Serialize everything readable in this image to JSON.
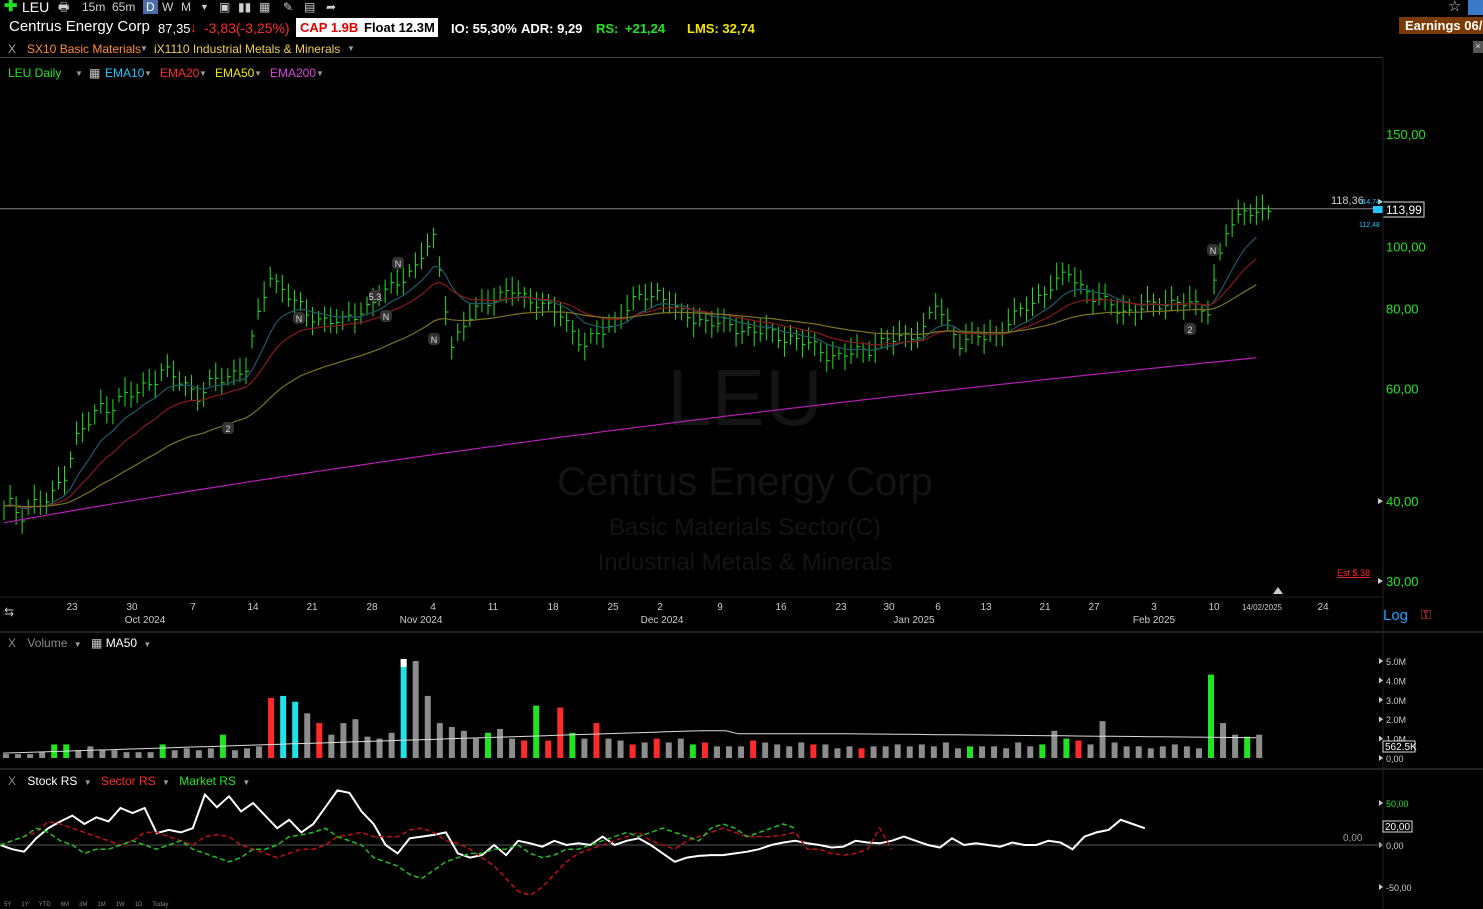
{
  "toolbar": {
    "symbol": "LEU",
    "timeframes": [
      "15m",
      "65m",
      "D",
      "W",
      "M"
    ],
    "active_timeframe": "D",
    "earnings_label": "Earnings 06/"
  },
  "info": {
    "company": "Centrus Energy Corp",
    "price": "87,35",
    "change": "-3,83(-3,25%)",
    "cap": "CAP 1.9B",
    "float": "Float 12.3M",
    "io": "IO: 55,30%",
    "adr": "ADR: 9,29",
    "rs_label": "RS:",
    "rs_value": "+21,24",
    "lms": "LMS: 32,74"
  },
  "sector": {
    "close": "X",
    "sector": "SX10 Basic Materials",
    "industry": "iX1110 Industrial Metals & Minerals"
  },
  "price_panel": {
    "legend": [
      {
        "label": "LEU Daily",
        "color": "#21e421"
      },
      {
        "label": "EMA10",
        "color": "#22c8ff"
      },
      {
        "label": "EMA20",
        "color": "#ff2a2a"
      },
      {
        "label": "EMA50",
        "color": "#f2e600"
      },
      {
        "label": "EMA200",
        "color": "#e040e0"
      }
    ],
    "watermark": {
      "symbol": "LEU",
      "company": "Centrus Energy Corp",
      "sector": "Basic Materials Sector(C)",
      "industry": "Industrial Metals & Minerals"
    },
    "y_ticks": [
      "150,00",
      "100,00",
      "80,00",
      "60,00",
      "40,00",
      "30,00"
    ],
    "hline_label": "118,36",
    "last_price": "113,99",
    "last_high": "114,74",
    "last_low": "112,48",
    "est_label": "Est $.38",
    "x_ticks": [
      "23",
      "30",
      "7",
      "14",
      "21",
      "28",
      "4",
      "11",
      "18",
      "25",
      "2",
      "9",
      "16",
      "23",
      "30",
      "6",
      "13",
      "21",
      "27",
      "3",
      "10",
      "14/02/2025",
      "24"
    ],
    "x_months": [
      "Oct 2024",
      "Nov 2024",
      "Dec 2024",
      "Jan 2025",
      "Feb 2025"
    ],
    "log_label": "Log",
    "markers": [
      "N",
      "N",
      "N",
      "N",
      "2",
      "2",
      "5.3",
      "N"
    ]
  },
  "volume_panel": {
    "legend": [
      {
        "label": "Volume",
        "color": "#888"
      },
      {
        "label": "MA50",
        "color": "#fff"
      }
    ],
    "y_ticks": [
      "5.0M",
      "4.0M",
      "3.0M",
      "2.0M",
      "1.0M",
      "0,00"
    ],
    "last_value": "562.5K"
  },
  "rs_panel": {
    "legend": [
      {
        "label": "Stock RS",
        "color": "#fff"
      },
      {
        "label": "Sector RS",
        "color": "#ff2a2a"
      },
      {
        "label": "Market RS",
        "color": "#21e421"
      }
    ],
    "y_ticks": [
      "50,00",
      "0,00",
      "-50,00"
    ],
    "zero_label": "0,00",
    "last_value": "20,00"
  },
  "bottom_ranges": [
    "5Y",
    "1Y",
    "YTD",
    "6M",
    "3M",
    "1M",
    "1W",
    "1D",
    "Today"
  ]
}
